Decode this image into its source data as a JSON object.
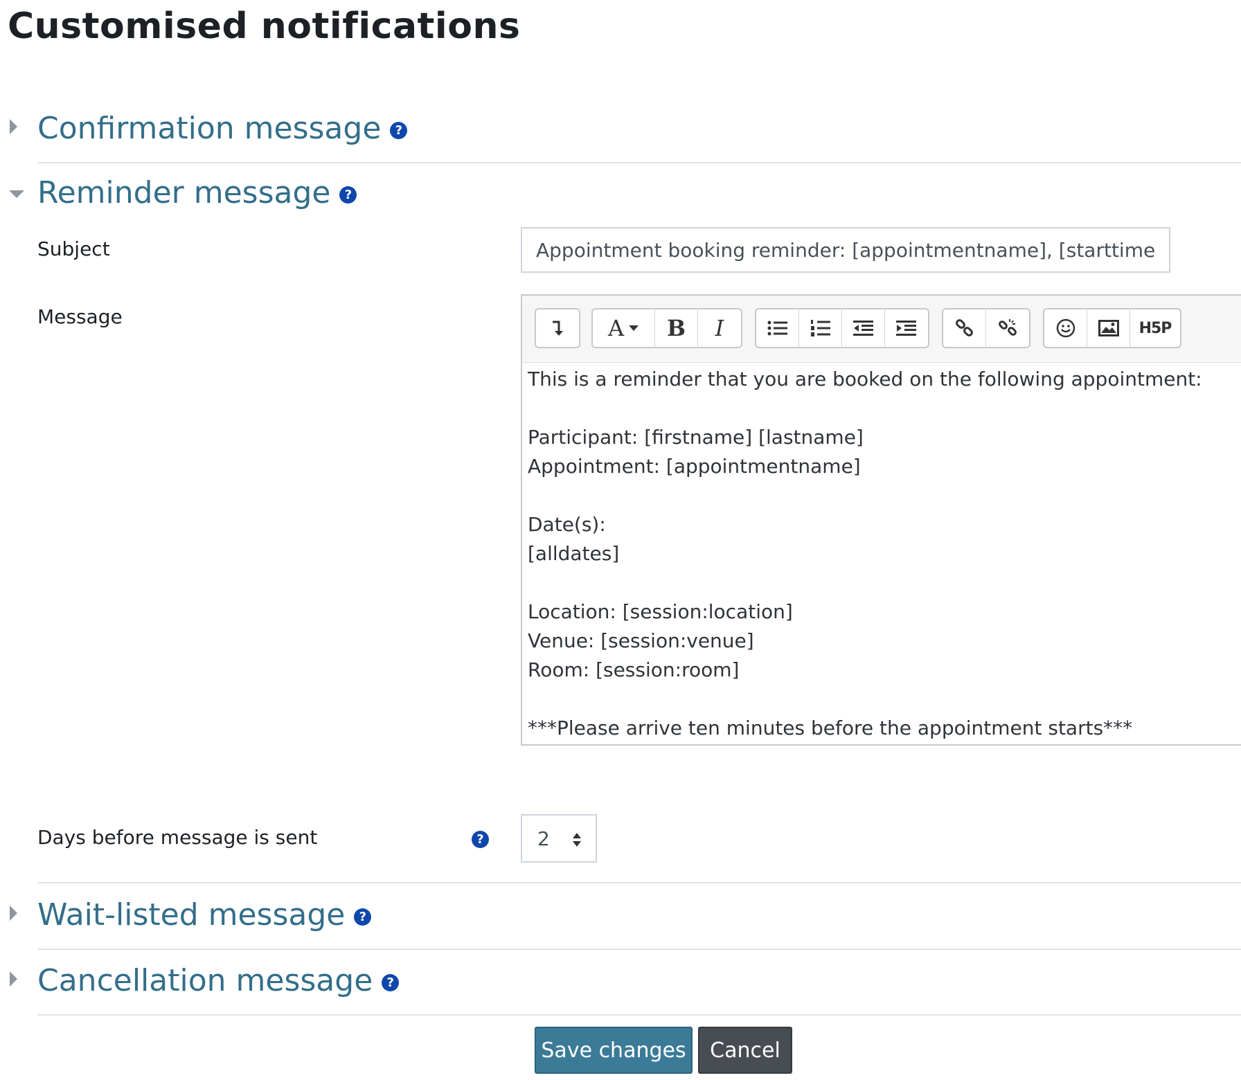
{
  "page": {
    "title": "Customised notifications"
  },
  "sections": {
    "confirmation": {
      "title": "Confirmation message",
      "expanded": false
    },
    "reminder": {
      "title": "Reminder message",
      "expanded": true,
      "subject_label": "Subject",
      "subject_value": "Appointment booking reminder: [appointmentname], [starttime]-[f",
      "message_label": "Message",
      "message_lines": [
        "This is a reminder that you are booked on the following appointment:",
        "",
        "Participant: [firstname] [lastname]",
        "Appointment: [appointmentname]",
        "",
        "Date(s):",
        "[alldates]",
        "",
        "Location: [session:location]",
        "Venue: [session:venue]",
        "Room: [session:room]",
        "",
        "***Please arrive ten minutes before the appointment starts***"
      ],
      "days_label": "Days before message is sent",
      "days_value": "2"
    },
    "waitlisted": {
      "title": "Wait-listed message",
      "expanded": false
    },
    "cancellation": {
      "title": "Cancellation message",
      "expanded": false
    }
  },
  "editor_toolbar": {
    "groups": [
      [
        "show-more-buttons-icon"
      ],
      [
        "font-color-icon",
        "bold-icon",
        "italic-icon"
      ],
      [
        "unordered-list-icon",
        "ordered-list-icon",
        "outdent-icon",
        "indent-icon"
      ],
      [
        "link-icon",
        "unlink-icon"
      ],
      [
        "emoji-icon",
        "image-icon",
        "h5p-icon"
      ]
    ],
    "glyphs": {
      "font_color": "A",
      "bold": "B",
      "italic": "I",
      "h5p": "H5P"
    }
  },
  "help_icon_glyph": "?",
  "actions": {
    "save_label": "Save changes",
    "cancel_label": "Cancel"
  },
  "colors": {
    "link": "#336e8a",
    "help_icon": "#0f47ad",
    "primary_button": "#3b7b98",
    "secondary_button": "#484d53"
  }
}
